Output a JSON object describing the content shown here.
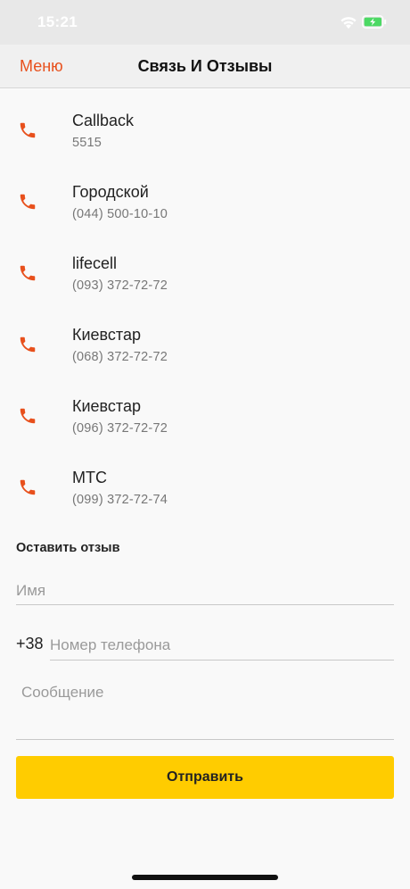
{
  "status_bar": {
    "time": "15:21",
    "icons": [
      "wifi-icon",
      "battery-charging-icon"
    ]
  },
  "nav": {
    "back_label": "Меню",
    "title": "Связь И Отзывы"
  },
  "contacts": [
    {
      "name": "Callback",
      "number": "5515",
      "icon": "phone-icon"
    },
    {
      "name": "Городской",
      "number": "(044) 500-10-10",
      "icon": "phone-icon"
    },
    {
      "name": "lifecell",
      "number": "(093) 372-72-72",
      "icon": "phone-icon"
    },
    {
      "name": "Киевстар",
      "number": "(068) 372-72-72",
      "icon": "phone-icon"
    },
    {
      "name": "Киевстар",
      "number": "(096) 372-72-72",
      "icon": "phone-icon"
    },
    {
      "name": "МТС",
      "number": "(099) 372-72-74",
      "icon": "phone-icon"
    }
  ],
  "feedback": {
    "heading": "Оставить отзыв",
    "name_placeholder": "Имя",
    "name_value": "",
    "phone_prefix": "+38",
    "phone_placeholder": "Номер телефона",
    "phone_value": "",
    "message_placeholder": "Сообщение",
    "message_value": "",
    "submit_label": "Отправить"
  },
  "colors": {
    "accent": "#e8501c",
    "submit": "#ffcc00",
    "background": "#f9f9f9",
    "nav_background": "#f0f0f0",
    "status_background": "#e8e8e8",
    "battery_charge": "#4cd964"
  }
}
